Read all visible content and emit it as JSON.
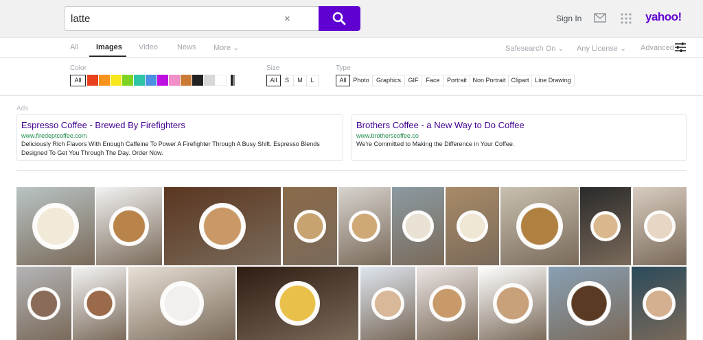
{
  "search": {
    "query": "latte",
    "clear_glyph": "×"
  },
  "header": {
    "sign_in": "Sign In",
    "logo": "yahoo!"
  },
  "tabs": [
    {
      "label": "All"
    },
    {
      "label": "Images"
    },
    {
      "label": "Video"
    },
    {
      "label": "News"
    },
    {
      "label": "More ⌄"
    }
  ],
  "tab_right": {
    "safesearch": "Safesearch On ⌄",
    "license": "Any License ⌄",
    "advanced": "Advanced"
  },
  "filters": {
    "color_label": "Color",
    "color_all": "All",
    "colors": [
      "#e8401c",
      "#f8931d",
      "#f8e71c",
      "#7ed321",
      "#2ec4a5",
      "#4a90e2",
      "#bd10e0",
      "#f08fc8",
      "#c97b36",
      "#222222",
      "#d8d8d8",
      "#ffffff",
      "bw"
    ],
    "size_label": "Size",
    "sizes": [
      "All",
      "S",
      "M",
      "L"
    ],
    "type_label": "Type",
    "types": [
      "All",
      "Photo",
      "Graphics",
      "GIF",
      "Face",
      "Portrait",
      "Non Portrait",
      "Clipart",
      "Line Drawing"
    ]
  },
  "ads": {
    "label": "Ads",
    "items": [
      {
        "title": "Espresso Coffee - Brewed By Firefighters",
        "url": "www.firedeptcoffee.com",
        "desc": "Deliciously Rich Flavors With Enough Caffeine To Power A Firefighter Through A Busy Shift. Espresso Blends Designed To Get You Through The Day. Order Now."
      },
      {
        "title": "Brothers Coffee - a New Way to Do Coffee",
        "url": "www.brotherscoffee.co",
        "desc": "We're Committed to Making the Difference in Your Coffee."
      }
    ]
  },
  "colors": {
    "accent": "#5f01d1",
    "ad_title": "#400090",
    "ad_url": "#1e8a4a"
  }
}
